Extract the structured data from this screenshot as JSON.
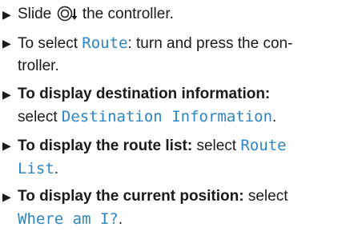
{
  "steps": [
    {
      "pre": "Slide",
      "icon": "controller-slide-down-icon",
      "post": "the controller."
    },
    {
      "pre": "To select",
      "ui": "Route",
      "post_line1": ": turn and press the con-",
      "post_line2": "troller."
    },
    {
      "bold": "To display destination information:",
      "pre": "select",
      "ui": "Destination Information",
      "post": "."
    },
    {
      "bold": "To display the route list:",
      "pre": "select",
      "ui_line1": "Route",
      "ui_line2": "List",
      "post": "."
    },
    {
      "bold": "To display the current position:",
      "pre": "select",
      "ui": "Where am I?",
      "post": "."
    }
  ],
  "colors": {
    "ui_text": "#2c86c8",
    "body_text": "#1a1a1a"
  }
}
